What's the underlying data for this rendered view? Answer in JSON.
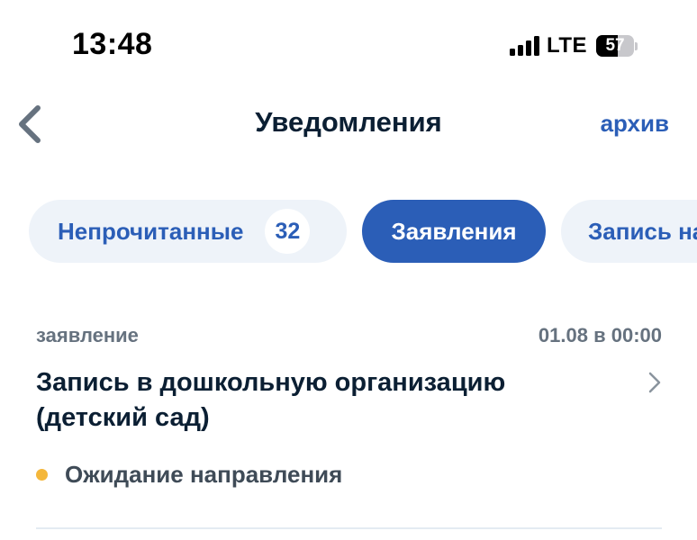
{
  "status_bar": {
    "time": "13:48",
    "network": "LTE",
    "battery_level": "57",
    "battery_fraction": 0.57
  },
  "nav": {
    "back_icon": "chevron-left-icon",
    "title": "Уведомления",
    "archive_label": "архив"
  },
  "chips": [
    {
      "label": "Непрочитанные",
      "count": "32",
      "selected": false
    },
    {
      "label": "Заявления",
      "selected": true
    },
    {
      "label": "Запись на",
      "selected": false
    }
  ],
  "notification": {
    "category": "заявление",
    "date": "01.08 в 00:00",
    "title": "Запись в дошкольную организацию (детский сад)",
    "status": "Ожидание направления",
    "status_color": "#f4b73b",
    "chevron_icon": "chevron-right-icon"
  },
  "colors": {
    "accent": "#2b5eb7",
    "chip_background": "#eef3f9",
    "text_primary": "#0b1f33",
    "text_secondary": "#66727f"
  }
}
